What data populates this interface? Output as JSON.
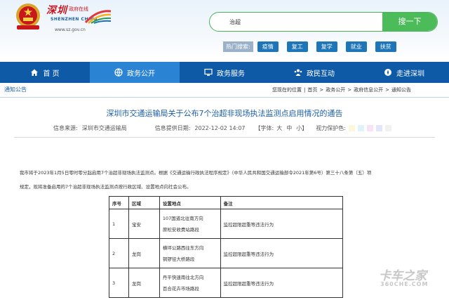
{
  "header": {
    "logo_cn": "深圳",
    "logo_gov": "政府在线",
    "logo_en": "SHENZHEN CHINA",
    "url": "www.sz.gov.cn",
    "search_value": "治超",
    "search_button": "搜一下",
    "hot_label": "热门搜索:",
    "hot_items": [
      "疫情",
      "复工",
      "复学",
      "就业",
      "扶贫"
    ]
  },
  "nav": {
    "items": [
      {
        "label": "首 页",
        "icon": "home-icon"
      },
      {
        "label": "政务公开",
        "icon": "globe-icon"
      },
      {
        "label": "政务服务",
        "icon": "monitor-icon"
      },
      {
        "label": "政民互动",
        "icon": "people-icon"
      },
      {
        "label": "走进深圳",
        "icon": "compass-icon"
      }
    ]
  },
  "breadcrumb": {
    "section": "通知公告",
    "prefix": "您现在的位置",
    "items": [
      "首页",
      "政务公开",
      "政府信息公开",
      "通知公告"
    ]
  },
  "article": {
    "title": "深圳市交通运输局关于公布7个治超非现场执法监测点启用情况的通告",
    "source_label": "信息来源:",
    "source": "深圳市交通运输局",
    "date_label": "信息提供日期:",
    "date": "2022-12-02 14:07",
    "font_label": "【字体:",
    "font_sizes": [
      "大",
      "中",
      "小"
    ],
    "font_end": "】",
    "vision_label": "视力保护色:",
    "vision_colors": [
      "#fdf7dc",
      "#dff3fc",
      "#f8e2f5",
      "#e3e6fa",
      "#f1f1f1"
    ],
    "paragraph1": "我市将于2023年1月5日零时零分起启用7个治超非现场执法监测点。根据《交通运输行政执法程序规定》（中华人民共和国交通运输部令2021年第6号）第三十八条第（五）项",
    "paragraph2": "规定，现将准备启用的7个治超非现场执法监测点按行政区域、设置地点向社会公布。"
  },
  "table": {
    "headers": [
      "序号",
      "区域",
      "设置地点",
      "备注"
    ],
    "rows": [
      {
        "no": "1",
        "area": "宝安",
        "loc1": "107国道北往南方向",
        "loc2": "原松安收费站路段",
        "note": "监控超限超重等违法行为"
      },
      {
        "no": "2",
        "area": "龙岗",
        "loc1": "横坪公路西往东方向",
        "loc2": "铜锣径大桥路段",
        "note": "监控超限超重等违法行为"
      },
      {
        "no": "3",
        "area": "龙岗",
        "loc1": "丹平快速南往北方向",
        "loc2": "百合花卉市场路段",
        "note": "监控超限超重等违法行为"
      }
    ]
  },
  "watermark": {
    "text": "卡车之家",
    "url": "360CHE.COM"
  }
}
